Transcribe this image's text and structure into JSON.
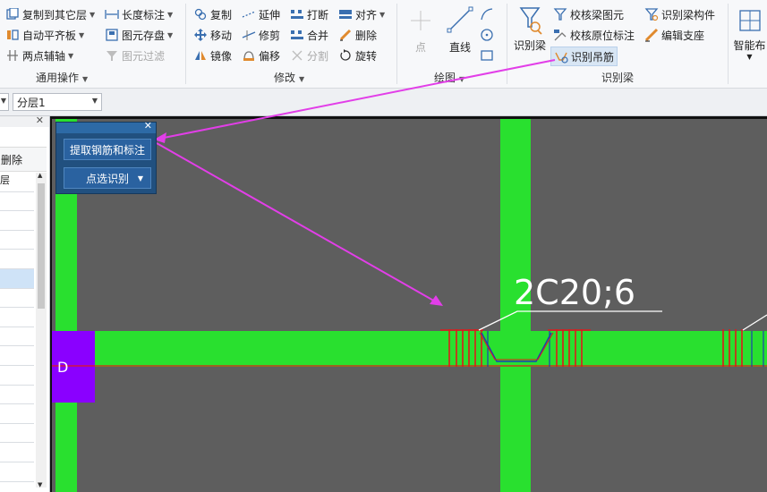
{
  "ribbon": {
    "general": {
      "items": [
        {
          "label": "复制到其它层",
          "dd": true,
          "icon": "copy-layer-icon"
        },
        {
          "label": "自动平齐板",
          "dd": true,
          "icon": "align-slab-icon"
        },
        {
          "label": "两点辅轴",
          "dd": true,
          "icon": "axis-icon"
        },
        {
          "label": "长度标注",
          "dd": true,
          "icon": "dimension-icon"
        },
        {
          "label": "图元存盘",
          "dd": true,
          "icon": "save-element-icon"
        },
        {
          "label": "图元过滤",
          "disabled": true,
          "icon": "filter-icon"
        }
      ],
      "group_label": "通用操作"
    },
    "modify": {
      "items": [
        {
          "label": "复制",
          "icon": "copy-icon"
        },
        {
          "label": "移动",
          "icon": "move-icon"
        },
        {
          "label": "镜像",
          "icon": "mirror-icon"
        },
        {
          "label": "延伸",
          "icon": "extend-icon"
        },
        {
          "label": "修剪",
          "icon": "trim-icon"
        },
        {
          "label": "偏移",
          "icon": "offset-icon"
        },
        {
          "label": "打断",
          "icon": "break-icon"
        },
        {
          "label": "合并",
          "icon": "merge-icon"
        },
        {
          "label": "分割",
          "disabled": true,
          "icon": "split-icon"
        },
        {
          "label": "对齐",
          "dd": true,
          "icon": "align-icon"
        },
        {
          "label": "删除",
          "icon": "delete-icon"
        },
        {
          "label": "旋转",
          "icon": "rotate-icon"
        }
      ],
      "group_label": "修改"
    },
    "draw": {
      "point_label": "点",
      "line_label": "直线",
      "group_label": "绘图"
    },
    "recognize": {
      "big_label": "识别梁",
      "items": [
        {
          "label": "校核梁图元",
          "icon": "check-beam-icon"
        },
        {
          "label": "校核原位标注",
          "icon": "check-annotation-icon"
        },
        {
          "label": "识别吊筋",
          "icon": "hanger-rebar-icon",
          "highlight": true
        },
        {
          "label": "识别梁构件",
          "icon": "identify-beam-component-icon"
        },
        {
          "label": "编辑支座",
          "icon": "edit-support-icon"
        }
      ],
      "group_label": "识别梁"
    },
    "smart": {
      "label": "智能布"
    }
  },
  "toolbar": {
    "layer_value": "分层1"
  },
  "left_panel": {
    "delete_label": "删除",
    "col_header": "层"
  },
  "float_panel": {
    "extract_label": "提取钢筋和标注",
    "pick_label": "点选识别"
  },
  "canvas": {
    "annotation": "2C20;6",
    "axis_label": "D"
  },
  "colors": {
    "beam": "#29e02f",
    "column": "#8a00ff",
    "rebar": "#e01a1a",
    "arrow": "#e23ee8",
    "panel": "#21507f"
  }
}
